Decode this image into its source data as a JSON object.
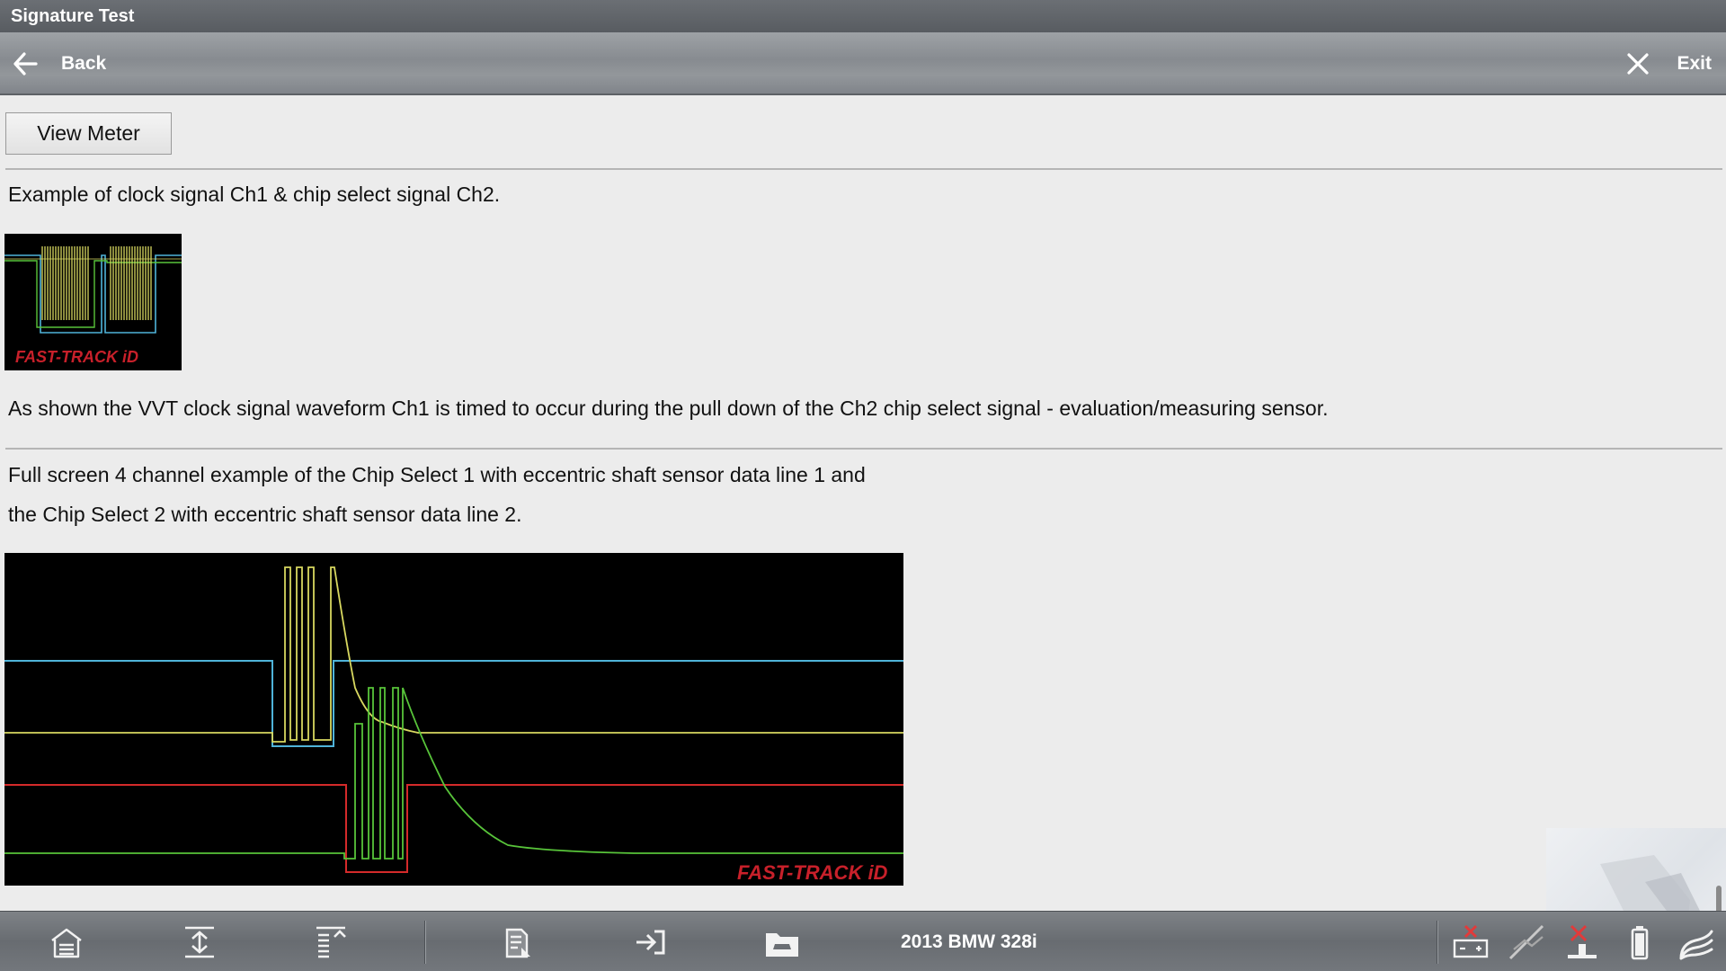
{
  "window": {
    "title": "Signature Test"
  },
  "nav": {
    "back_label": "Back",
    "exit_label": "Exit"
  },
  "main": {
    "view_meter_label": "View Meter",
    "caption1": "Example of clock signal Ch1 & chip select signal Ch2.",
    "caption2": "As shown the VVT clock signal waveform Ch1 is timed to occur during the pull down of the Ch2 chip select signal - evaluation/measuring sensor.",
    "caption3_line1": "Full screen 4 channel example of the Chip Select 1 with eccentric shaft sensor data line 1 and",
    "caption3_line2": "the Chip Select 2 with eccentric shaft sensor data line 2.",
    "image_brand": "FAST-TRACK iD"
  },
  "bottom_bar": {
    "vehicle": "2013 BMW 328i",
    "icons": [
      "home-icon",
      "expand-icon",
      "collapse-icon",
      "report-icon",
      "exit-to-icon",
      "vehicle-folder-icon",
      "battery-disconnected-icon",
      "scope-disconnected-icon",
      "meter-disconnected-icon",
      "battery-level-icon",
      "wifi-icon"
    ]
  },
  "colors": {
    "ch_cyan": "#4fb3d9",
    "ch_yellow": "#d8d860",
    "ch_red": "#d42a2a",
    "ch_green": "#58c43a",
    "brand_red": "#c8202a"
  }
}
